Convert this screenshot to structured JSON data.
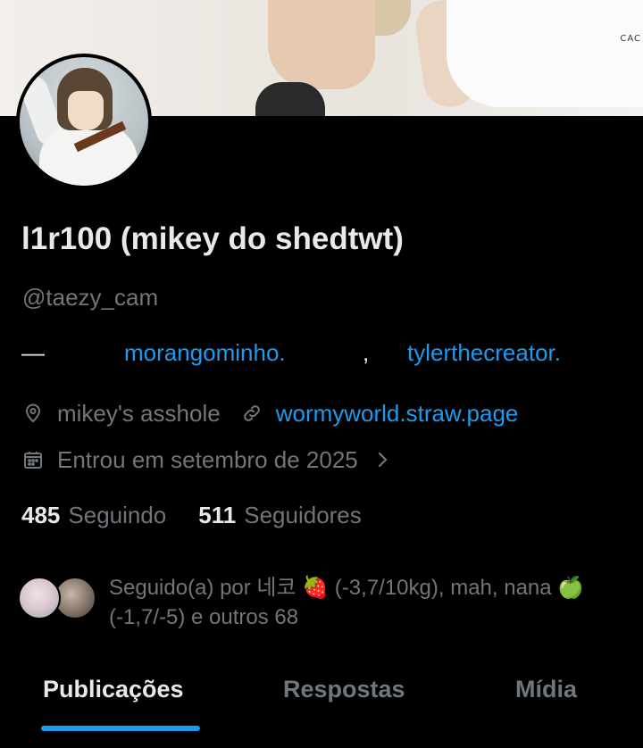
{
  "profile": {
    "display_name": "l1r100 (mikey do shedtwt)",
    "handle": "@taezy_cam",
    "bio": {
      "dash": "—",
      "mention1": "morangominho.",
      "separator": ",",
      "mention2": "tylerthecreator."
    },
    "location": "mikey's asshole",
    "website": "wormyworld.straw.page",
    "joined": "Entrou em setembro de 2025",
    "following_count": "485",
    "following_label": "Seguindo",
    "followers_count": "511",
    "followers_label": "Seguidores",
    "followed_by_text": "Seguido(a) por 네코 🍓 (-3,7/10kg), mah, nana 🍏 (-1,7/-5) e outros 68"
  },
  "banner": {
    "partial_text": "CAC"
  },
  "tabs": [
    {
      "label": "Publicações",
      "active": true
    },
    {
      "label": "Respostas",
      "active": false
    },
    {
      "label": "Mídia",
      "active": false
    }
  ],
  "icons": {
    "location": "map-pin-icon",
    "website": "link-icon",
    "joined": "calendar-icon",
    "chevron": "chevron-right-icon"
  },
  "colors": {
    "background": "#000000",
    "primary_text": "#e7e9ea",
    "secondary_text": "#71767b",
    "accent": "#1d9bf0"
  }
}
